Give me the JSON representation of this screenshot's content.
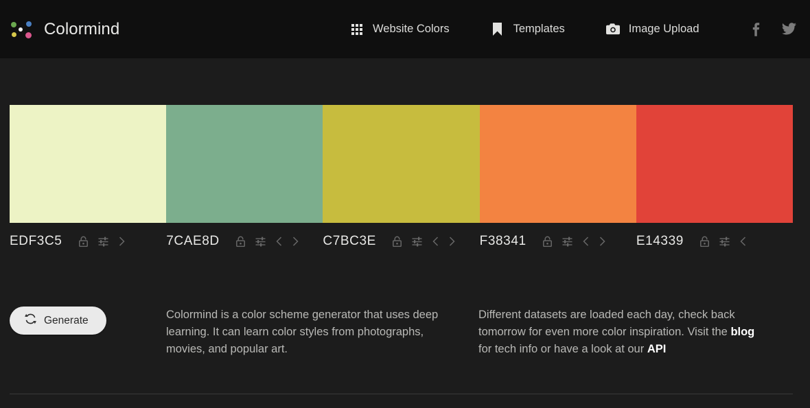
{
  "header": {
    "brand_name": "Colormind",
    "logo_icon": "colormind-dots-logo",
    "nav": [
      {
        "label": "Website Colors",
        "icon": "grid-icon"
      },
      {
        "label": "Templates",
        "icon": "bookmark-icon"
      },
      {
        "label": "Image Upload",
        "icon": "camera-icon"
      }
    ],
    "social": [
      {
        "name": "facebook-icon"
      },
      {
        "name": "twitter-icon"
      }
    ],
    "background": "#0f0f0f"
  },
  "palette": {
    "swatches": [
      {
        "hex": "EDF3C5",
        "color": "#EDF3C5",
        "lock_state": "unlocked",
        "has_prev": false,
        "has_next": true
      },
      {
        "hex": "7CAE8D",
        "color": "#7CAE8D",
        "lock_state": "unlocked",
        "has_prev": true,
        "has_next": true
      },
      {
        "hex": "C7BC3E",
        "color": "#C7BC3E",
        "lock_state": "unlocked",
        "has_prev": true,
        "has_next": true
      },
      {
        "hex": "F38341",
        "color": "#F38341",
        "lock_state": "unlocked",
        "has_prev": true,
        "has_next": true
      },
      {
        "hex": "E14339",
        "color": "#E14339",
        "lock_state": "unlocked",
        "has_prev": true,
        "has_next": false
      }
    ],
    "controls": {
      "lock_icon": "unlocked-padlock-icon",
      "adjust_icon": "sliders-icon",
      "prev_icon": "chevron-left-icon",
      "next_icon": "chevron-right-icon"
    }
  },
  "actions": {
    "generate_label": "Generate",
    "generate_icon": "refresh-icon"
  },
  "info": {
    "left_paragraph": "Colormind is a color scheme generator that uses deep learning. It can learn color styles from photographs, movies, and popular art.",
    "right_paragraph_part1": "Different datasets are loaded each day, check back tomorrow for even more color inspiration. Visit the ",
    "right_link_blog": "blog",
    "right_paragraph_part2": " for tech info or have a look at our ",
    "right_link_api": "API"
  },
  "theme": {
    "page_background": "#1c1c1c",
    "header_background": "#0f0f0f",
    "text_primary": "#e8e8e6",
    "text_secondary": "#b9b9b6",
    "divider": "#3a3a3a",
    "button_background": "#eaeaea"
  }
}
